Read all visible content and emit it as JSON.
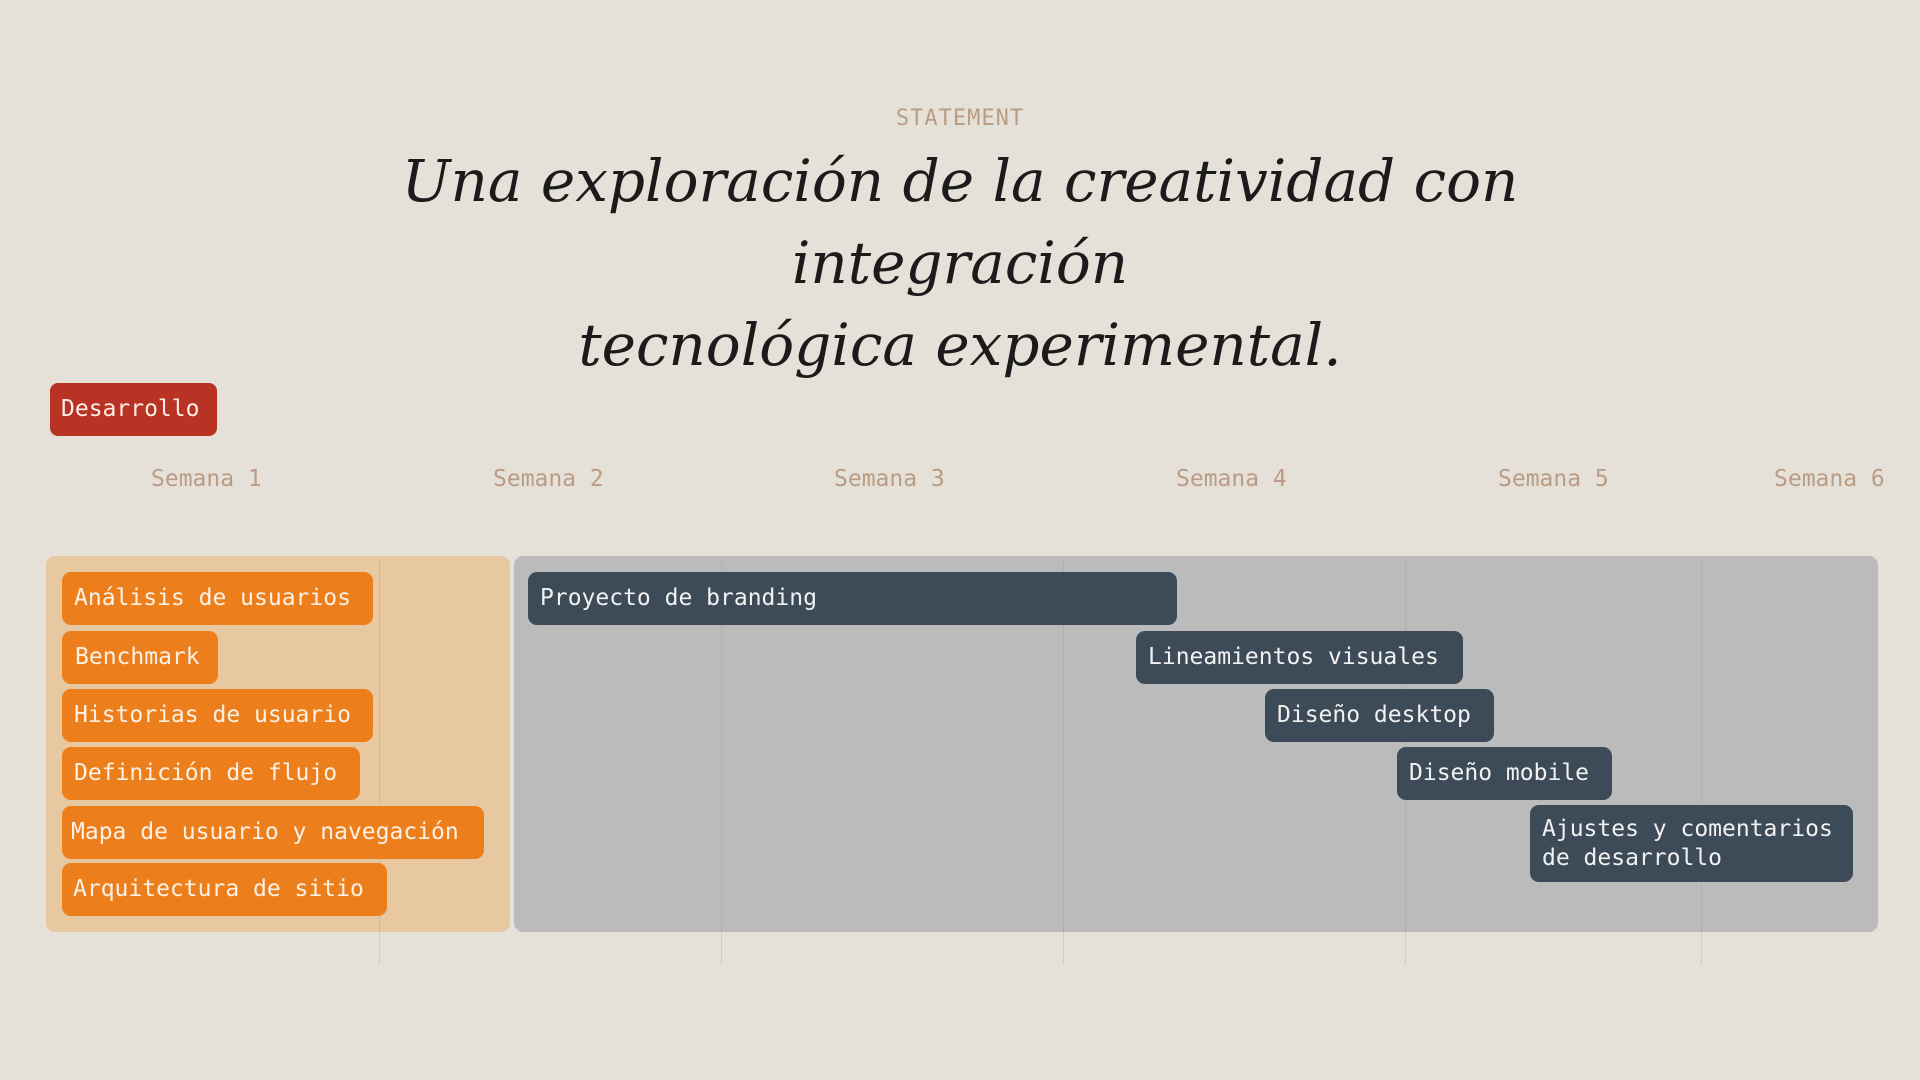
{
  "eyebrow": "STATEMENT",
  "headline": {
    "line1": "Una exploración de la creatividad con integración",
    "line2": "tecnológica experimental."
  },
  "phase_tag": "Desarrollo",
  "weeks": [
    "Semana 1",
    "Semana 2",
    "Semana 3",
    "Semana 4",
    "Semana 5",
    "Semana 6"
  ],
  "left_tasks": [
    "Análisis de usuarios",
    "Benchmark",
    "Historias de usuario",
    "Definición de flujo",
    "Mapa de usuario y navegación",
    "Arquitectura de sitio"
  ],
  "right_tasks": {
    "branding": "Proyecto de branding",
    "lineamientos": "Lineamientos visuales",
    "desktop": "Diseño desktop",
    "mobile": "Diseño mobile",
    "ajustes_line1": "Ajustes y comentarios",
    "ajustes_line2": "de desarrollo"
  },
  "colors": {
    "background": "#e5e1d8",
    "accent_red": "#b93324",
    "orange": "#ec7f1c",
    "slate": "#3d4a58",
    "muted_tan": "#b99c83",
    "panel_left": "#e8c8a0",
    "panel_right": "#bbbbbb"
  }
}
